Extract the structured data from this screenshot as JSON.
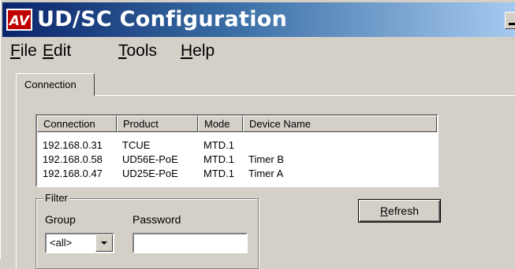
{
  "window": {
    "title": "UD/SC Configuration",
    "icon": "av-logo-icon"
  },
  "menu": {
    "items": [
      {
        "label": "File",
        "mnemonic": "F"
      },
      {
        "label": "Edit",
        "mnemonic": "E"
      },
      {
        "label": "Tools",
        "mnemonic": "T"
      },
      {
        "label": "Help",
        "mnemonic": "H"
      }
    ]
  },
  "tabs": [
    {
      "label": "Connection",
      "selected": true
    }
  ],
  "connection_list": {
    "columns": [
      "Connection",
      "Product",
      "Mode",
      "Device Name"
    ],
    "rows": [
      {
        "connection": "192.168.0.31",
        "product": "TCUE",
        "mode": "MTD.1",
        "device_name": ""
      },
      {
        "connection": "192.168.0.58",
        "product": "UD56E-PoE",
        "mode": "MTD.1",
        "device_name": "Timer B"
      },
      {
        "connection": "192.168.0.47",
        "product": "UD25E-PoE",
        "mode": "MTD.1",
        "device_name": "Timer A"
      }
    ]
  },
  "filter": {
    "legend": "Filter",
    "group_label": "Group",
    "group_value": "<all>",
    "password_label": "Password",
    "password_value": ""
  },
  "buttons": {
    "refresh": "Refresh"
  }
}
